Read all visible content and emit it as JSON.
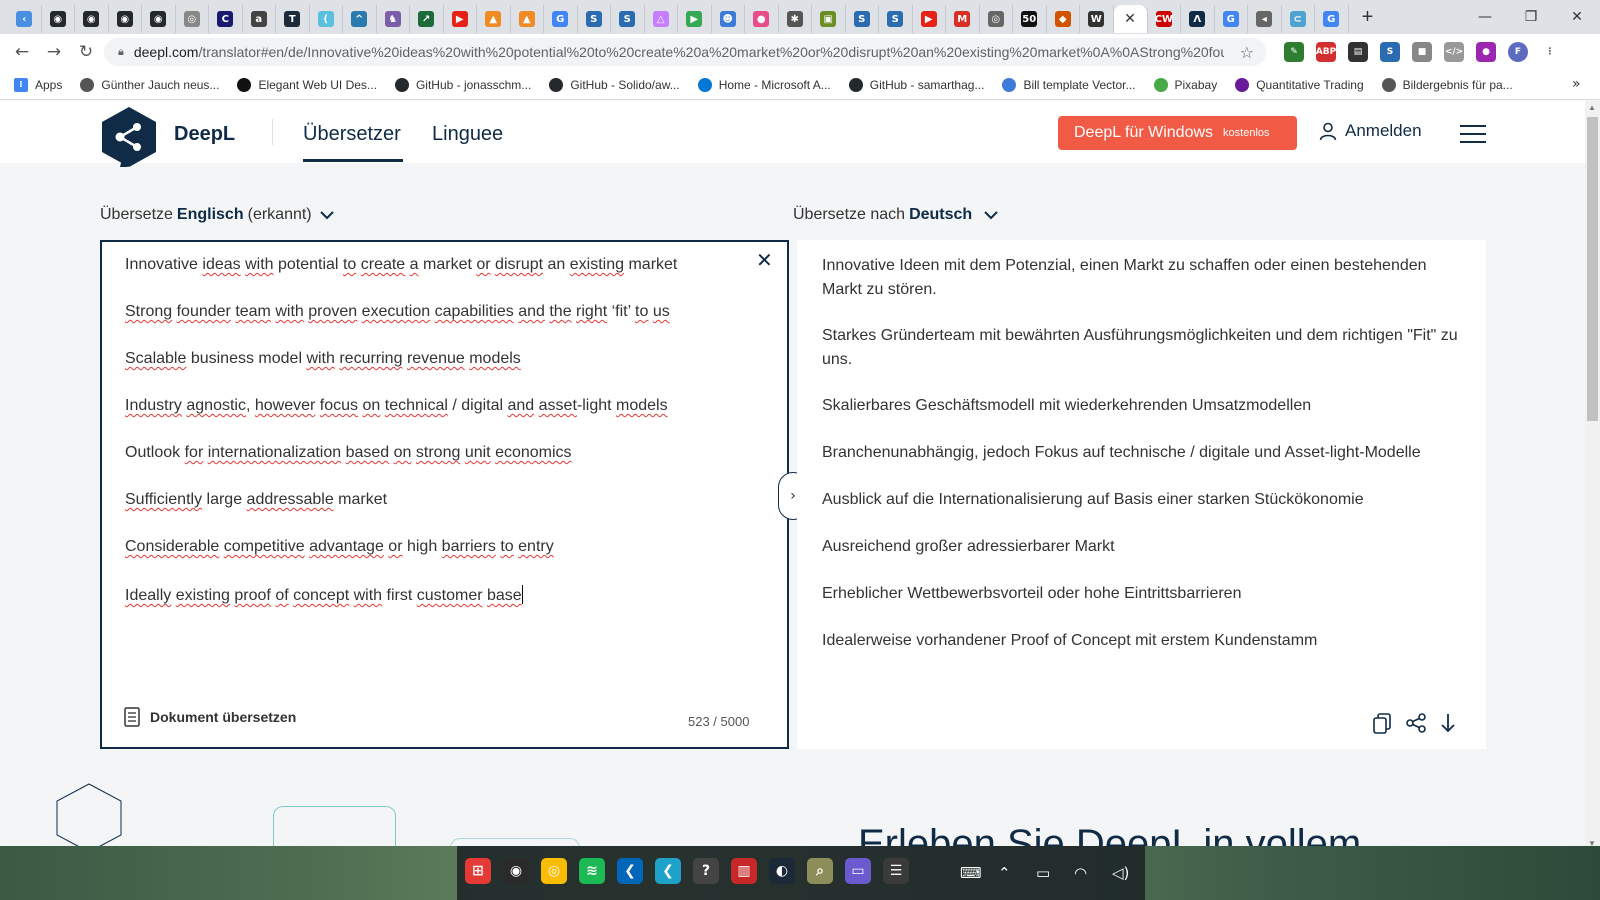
{
  "browser": {
    "tabs": [
      {
        "icon": "back-arrow-icon",
        "color": "#4a90e2",
        "glyph": "‹"
      },
      {
        "icon": "github-icon",
        "color": "#24292e",
        "glyph": "◉"
      },
      {
        "icon": "github-icon",
        "color": "#24292e",
        "glyph": "◉"
      },
      {
        "icon": "github-icon",
        "color": "#24292e",
        "glyph": "◉"
      },
      {
        "icon": "github-icon",
        "color": "#24292e",
        "glyph": "◉"
      },
      {
        "icon": "globe-icon",
        "color": "#888888",
        "glyph": "◎"
      },
      {
        "icon": "c-icon",
        "color": "#1a1a6e",
        "glyph": "C"
      },
      {
        "icon": "a-icon",
        "color": "#444444",
        "glyph": "a"
      },
      {
        "icon": "t-icon",
        "color": "#1c2a3a",
        "glyph": "T"
      },
      {
        "icon": "crescent-icon",
        "color": "#5bc0de",
        "glyph": "("
      },
      {
        "icon": "arrow-icon",
        "color": "#2a7ab0",
        "glyph": "^"
      },
      {
        "icon": "cat-icon",
        "color": "#7b5ea7",
        "glyph": "♞"
      },
      {
        "icon": "chart-icon",
        "color": "#1e6b3a",
        "glyph": "↗"
      },
      {
        "icon": "youtube-icon",
        "color": "#e62117",
        "glyph": "▶"
      },
      {
        "icon": "orange-icon",
        "color": "#f08a24",
        "glyph": "▲"
      },
      {
        "icon": "orange-icon",
        "color": "#f08a24",
        "glyph": "▲"
      },
      {
        "icon": "google-icon",
        "color": "#4285f4",
        "glyph": "G"
      },
      {
        "icon": "s-icon",
        "color": "#2b6cb0",
        "glyph": "S"
      },
      {
        "icon": "s-icon",
        "color": "#2b6cb0",
        "glyph": "S"
      },
      {
        "icon": "triangle-icon",
        "color": "#c77dff",
        "glyph": "△"
      },
      {
        "icon": "play-store-icon",
        "color": "#34a853",
        "glyph": "▶"
      },
      {
        "icon": "bot-icon",
        "color": "#3d7bd9",
        "glyph": "☻"
      },
      {
        "icon": "dribbble-icon",
        "color": "#ea4c89",
        "glyph": "●"
      },
      {
        "icon": "puzzle-icon",
        "color": "#555555",
        "glyph": "✱"
      },
      {
        "icon": "image-icon",
        "color": "#6b8e23",
        "glyph": "▣"
      },
      {
        "icon": "s-icon",
        "color": "#2b6cb0",
        "glyph": "S"
      },
      {
        "icon": "s-icon",
        "color": "#2b6cb0",
        "glyph": "S"
      },
      {
        "icon": "youtube-icon",
        "color": "#e62117",
        "glyph": "▶"
      },
      {
        "icon": "gmail-icon",
        "color": "#d93025",
        "glyph": "M"
      },
      {
        "icon": "globe-icon",
        "color": "#666666",
        "glyph": "◎"
      },
      {
        "icon": "fifty-icon",
        "color": "#111111",
        "glyph": "50"
      },
      {
        "icon": "flag-icon",
        "color": "#d35400",
        "glyph": "◆"
      },
      {
        "icon": "wikipedia-icon",
        "color": "#333333",
        "glyph": "W"
      },
      {
        "icon": "cw-icon",
        "color": "#cc0000",
        "glyph": "CW"
      },
      {
        "icon": "a-triangle-icon",
        "color": "#0f2b46",
        "glyph": "Λ"
      },
      {
        "icon": "google-icon",
        "color": "#4285f4",
        "glyph": "G"
      },
      {
        "icon": "speaker-icon",
        "color": "#666666",
        "glyph": "◂"
      },
      {
        "icon": "pill-icon",
        "color": "#4fa3d1",
        "glyph": "⊂"
      },
      {
        "icon": "google-icon",
        "color": "#4285f4",
        "glyph": "G"
      }
    ],
    "active_tab_index": 33,
    "url_host": "deepl.com",
    "url_rest": "/translator#en/de/Innovative%20ideas%20with%20potential%20to%20create%20a%20market%20or%20disrupt%20an%20existing%20market%0A%0AStrong%20foun...",
    "extensions": [
      {
        "icon": "pen-extension-icon",
        "color": "#2e7d32",
        "glyph": "✎"
      },
      {
        "icon": "adblock-icon",
        "color": "#d32f2f",
        "glyph": "ABP"
      },
      {
        "icon": "extension-icon",
        "color": "#333333",
        "glyph": "▤"
      },
      {
        "icon": "s-extension-icon",
        "color": "#2b6cb0",
        "glyph": "S"
      },
      {
        "icon": "disk-extension-icon",
        "color": "#888888",
        "glyph": "■"
      },
      {
        "icon": "code-extension-icon",
        "color": "#999999",
        "glyph": "</>"
      },
      {
        "icon": "circle-extension-icon",
        "color": "#9c27b0",
        "glyph": "●"
      },
      {
        "icon": "profile-avatar-icon",
        "color": "#5c6bc0",
        "glyph": "F"
      }
    ],
    "bookmarks": [
      {
        "label": "Apps",
        "icon": "apps-grid-icon",
        "color": "#4285f4"
      },
      {
        "label": "Günther Jauch neus...",
        "icon": "globe-icon",
        "color": "#555555"
      },
      {
        "label": "Elegant Web UI Des...",
        "icon": "a-icon",
        "color": "#111111"
      },
      {
        "label": "GitHub - jonasschm...",
        "icon": "github-icon",
        "color": "#24292e"
      },
      {
        "label": "GitHub - Solido/aw...",
        "icon": "github-icon",
        "color": "#24292e"
      },
      {
        "label": "Home - Microsoft A...",
        "icon": "azure-icon",
        "color": "#0078d4"
      },
      {
        "label": "GitHub - samarthag...",
        "icon": "github-icon",
        "color": "#24292e"
      },
      {
        "label": "Bill template Vector...",
        "icon": "gear-icon",
        "color": "#3d7bd9"
      },
      {
        "label": "Pixabay",
        "icon": "pixabay-icon",
        "color": "#48a947"
      },
      {
        "label": "Quantitative Trading",
        "icon": "q-icon",
        "color": "#6a1b9a"
      },
      {
        "label": "Bildergebnis für pa...",
        "icon": "globe-icon",
        "color": "#555555"
      }
    ]
  },
  "header": {
    "brand": "DeepL",
    "nav_translator": "Übersetzer",
    "nav_linguee": "Linguee",
    "cta_main": "DeepL für Windows",
    "cta_small": "kostenlos",
    "login": "Anmelden",
    "brand_color": "#0f2b46",
    "cta_color": "#f15a45"
  },
  "source": {
    "prefix": "Übersetze",
    "language": "Englisch",
    "suffix": "(erkannt)",
    "lines": [
      [
        {
          "t": "Innovative ",
          "s": false
        },
        {
          "t": "ideas",
          "s": true
        },
        {
          "t": " ",
          "s": false
        },
        {
          "t": "with",
          "s": true
        },
        {
          "t": " potential ",
          "s": false
        },
        {
          "t": "to",
          "s": true
        },
        {
          "t": " ",
          "s": false
        },
        {
          "t": "create",
          "s": true
        },
        {
          "t": " ",
          "s": false
        },
        {
          "t": "a",
          "s": true
        },
        {
          "t": " market ",
          "s": false
        },
        {
          "t": "or",
          "s": true
        },
        {
          "t": " ",
          "s": false
        },
        {
          "t": "disrupt",
          "s": true
        },
        {
          "t": " an ",
          "s": false
        },
        {
          "t": "existing",
          "s": true
        },
        {
          "t": " market",
          "s": false
        }
      ],
      [
        {
          "t": "Strong",
          "s": true
        },
        {
          "t": " ",
          "s": false
        },
        {
          "t": "founder",
          "s": true
        },
        {
          "t": " ",
          "s": false
        },
        {
          "t": "team",
          "s": true
        },
        {
          "t": " ",
          "s": false
        },
        {
          "t": "with",
          "s": true
        },
        {
          "t": " ",
          "s": false
        },
        {
          "t": "proven",
          "s": true
        },
        {
          "t": " ",
          "s": false
        },
        {
          "t": "execution",
          "s": true
        },
        {
          "t": " ",
          "s": false
        },
        {
          "t": "capabilities",
          "s": true
        },
        {
          "t": " ",
          "s": false
        },
        {
          "t": "and",
          "s": true
        },
        {
          "t": " ",
          "s": false
        },
        {
          "t": "the",
          "s": true
        },
        {
          "t": " ",
          "s": false
        },
        {
          "t": "right",
          "s": true
        },
        {
          "t": " ‘fit’ ",
          "s": false
        },
        {
          "t": "to",
          "s": true
        },
        {
          "t": " ",
          "s": false
        },
        {
          "t": "us",
          "s": true
        }
      ],
      [
        {
          "t": "Scalable",
          "s": true
        },
        {
          "t": " business model ",
          "s": false
        },
        {
          "t": "with",
          "s": true
        },
        {
          "t": " ",
          "s": false
        },
        {
          "t": "recurring",
          "s": true
        },
        {
          "t": " ",
          "s": false
        },
        {
          "t": "revenue",
          "s": true
        },
        {
          "t": " ",
          "s": false
        },
        {
          "t": "models",
          "s": true
        }
      ],
      [
        {
          "t": "Industry",
          "s": true
        },
        {
          "t": " ",
          "s": false
        },
        {
          "t": "agnostic",
          "s": true
        },
        {
          "t": ", ",
          "s": false
        },
        {
          "t": "however",
          "s": true
        },
        {
          "t": " ",
          "s": false
        },
        {
          "t": "focus",
          "s": true
        },
        {
          "t": " ",
          "s": false
        },
        {
          "t": "on",
          "s": true
        },
        {
          "t": " ",
          "s": false
        },
        {
          "t": "technical",
          "s": true
        },
        {
          "t": " / digital ",
          "s": false
        },
        {
          "t": "and",
          "s": true
        },
        {
          "t": " ",
          "s": false
        },
        {
          "t": "asset",
          "s": true
        },
        {
          "t": "-light ",
          "s": false
        },
        {
          "t": "models",
          "s": true
        }
      ],
      [
        {
          "t": "Outlook ",
          "s": false
        },
        {
          "t": "for",
          "s": true
        },
        {
          "t": " ",
          "s": false
        },
        {
          "t": "internationalization",
          "s": true
        },
        {
          "t": " ",
          "s": false
        },
        {
          "t": "based",
          "s": true
        },
        {
          "t": " ",
          "s": false
        },
        {
          "t": "on",
          "s": true
        },
        {
          "t": " ",
          "s": false
        },
        {
          "t": "strong",
          "s": true
        },
        {
          "t": " ",
          "s": false
        },
        {
          "t": "unit",
          "s": true
        },
        {
          "t": " ",
          "s": false
        },
        {
          "t": "economics",
          "s": true
        }
      ],
      [
        {
          "t": "Sufficiently",
          "s": true
        },
        {
          "t": " large ",
          "s": false
        },
        {
          "t": "addressable",
          "s": true
        },
        {
          "t": " market",
          "s": false
        }
      ],
      [
        {
          "t": "Considerable",
          "s": true
        },
        {
          "t": " ",
          "s": false
        },
        {
          "t": "competitive",
          "s": true
        },
        {
          "t": " ",
          "s": false
        },
        {
          "t": "advantage",
          "s": true
        },
        {
          "t": " ",
          "s": false
        },
        {
          "t": "or",
          "s": true
        },
        {
          "t": " high ",
          "s": false
        },
        {
          "t": "barriers",
          "s": true
        },
        {
          "t": " ",
          "s": false
        },
        {
          "t": "to",
          "s": true
        },
        {
          "t": " ",
          "s": false
        },
        {
          "t": "entry",
          "s": true
        }
      ],
      [
        {
          "t": "Ideally",
          "s": true
        },
        {
          "t": " ",
          "s": false
        },
        {
          "t": "existing",
          "s": true
        },
        {
          "t": " ",
          "s": false
        },
        {
          "t": "proof",
          "s": true
        },
        {
          "t": " ",
          "s": false
        },
        {
          "t": "of",
          "s": true
        },
        {
          "t": " ",
          "s": false
        },
        {
          "t": "concept",
          "s": true
        },
        {
          "t": " ",
          "s": false
        },
        {
          "t": "with",
          "s": true
        },
        {
          "t": " first ",
          "s": false
        },
        {
          "t": "customer",
          "s": true
        },
        {
          "t": " ",
          "s": false
        },
        {
          "t": "base",
          "s": true
        }
      ]
    ],
    "doc_button": "Dokument übersetzen",
    "counter": "523 / 5000"
  },
  "target": {
    "prefix": "Übersetze nach",
    "language": "Deutsch",
    "lines": [
      "Innovative Ideen mit dem Potenzial, einen Markt zu schaffen oder einen bestehenden Markt zu stören.",
      "Starkes Gründerteam mit bewährten Ausführungsmöglichkeiten und dem richtigen \"Fit\" zu uns.",
      "Skalierbares Geschäftsmodell mit wiederkehrenden Umsatzmodellen",
      "Branchenunabhängig, jedoch Fokus auf technische / digitale und Asset-light-Modelle",
      "Ausblick auf die Internationalisierung auf Basis einer starken Stückökonomie",
      "Ausreichend großer adressierbarer Markt",
      "Erheblicher Wettbewerbsvorteil oder hohe Eintrittsbarrieren",
      "Idealerweise vorhandener Proof of Concept mit erstem Kundenstamm"
    ]
  },
  "below_fold": {
    "headline": "Erleben Sie DeepL in vollem"
  },
  "taskbar": {
    "apps": [
      {
        "icon": "windows-start-icon",
        "color": "#e53935",
        "glyph": "⊞"
      },
      {
        "icon": "obs-icon",
        "color": "#2a2a2a",
        "glyph": "◉"
      },
      {
        "icon": "chrome-icon",
        "color": "#fbbc04",
        "glyph": "◎"
      },
      {
        "icon": "spotify-icon",
        "color": "#1db954",
        "glyph": "≋"
      },
      {
        "icon": "vscode-icon",
        "color": "#0066b8",
        "glyph": "❮"
      },
      {
        "icon": "vscode-insiders-icon",
        "color": "#1ea2c9",
        "glyph": "❮"
      },
      {
        "icon": "help-icon",
        "color": "#444444",
        "glyph": "?"
      },
      {
        "icon": "trash-icon",
        "color": "#c62828",
        "glyph": "▥"
      },
      {
        "icon": "steam-icon",
        "color": "#1b2838",
        "glyph": "◐"
      },
      {
        "icon": "search-tool-icon",
        "color": "#8d8d5a",
        "glyph": "⌕"
      },
      {
        "icon": "folder-icon",
        "color": "#6a5acd",
        "glyph": "▭"
      },
      {
        "icon": "notes-icon",
        "color": "#3a3a3a",
        "glyph": "☰"
      }
    ],
    "tray": [
      {
        "icon": "keyboard-icon",
        "glyph": "⌨"
      },
      {
        "icon": "chevron-up-icon",
        "glyph": "⌃"
      },
      {
        "icon": "battery-icon",
        "glyph": "▭"
      },
      {
        "icon": "wifi-icon",
        "glyph": "◠"
      },
      {
        "icon": "volume-icon",
        "glyph": "◁)"
      }
    ]
  }
}
